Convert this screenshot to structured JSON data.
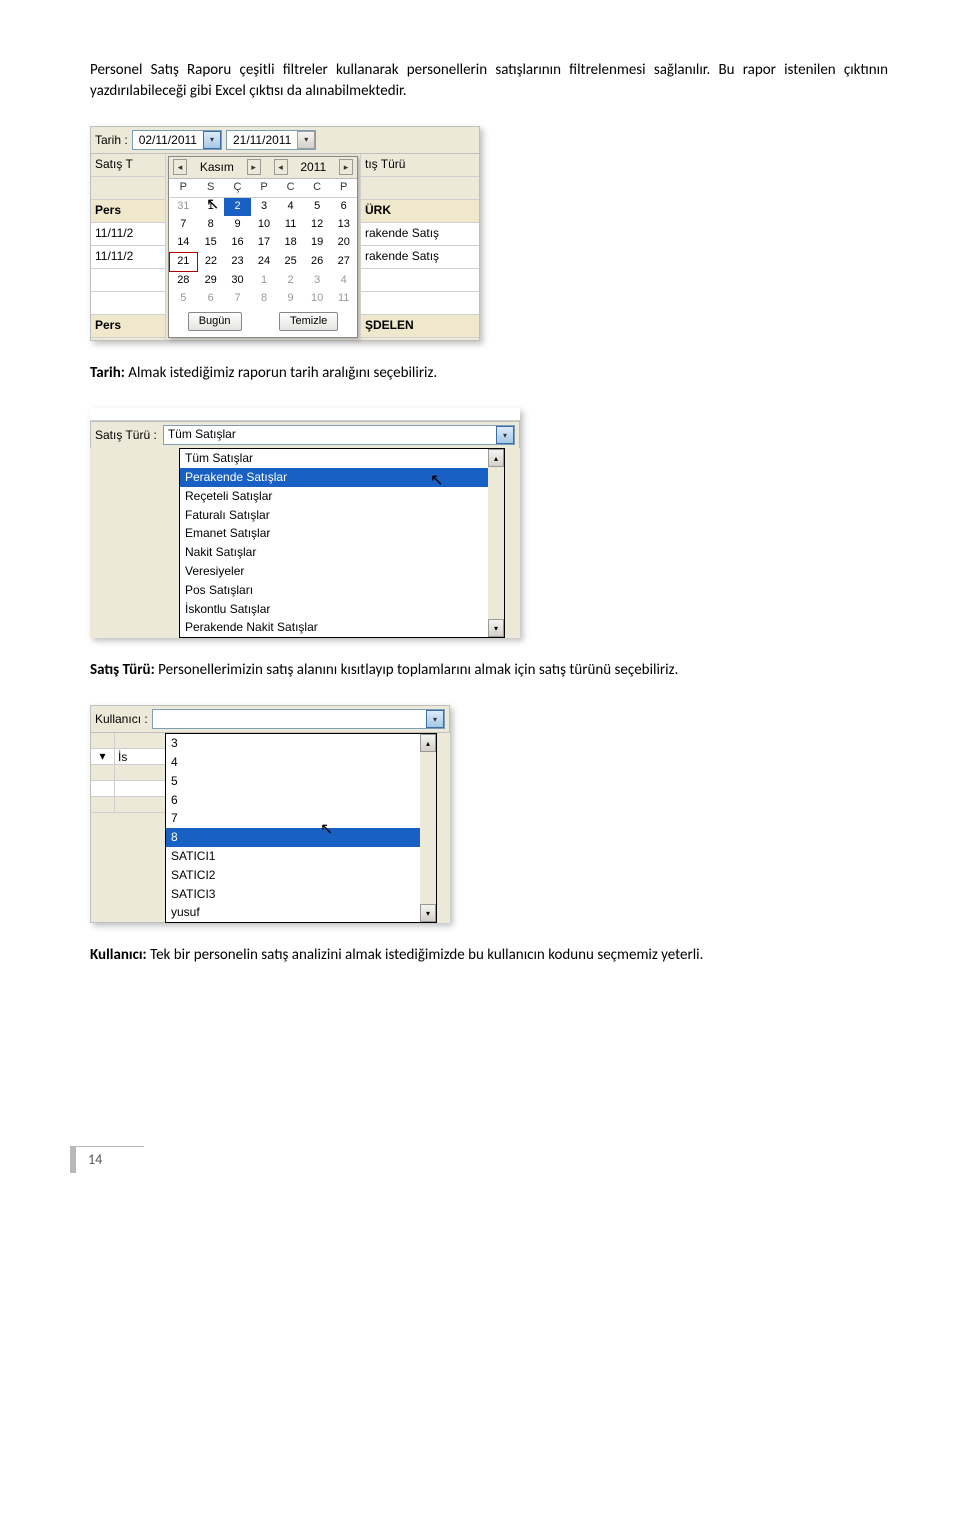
{
  "intro": "Personel Satış Raporu çeşitli filtreler kullanarak personellerin satışlarının filtrelenmesi sağlanılır. Bu rapor istenilen çıktının yazdırılabileceği gibi Excel çıktısı da alınabilmektedir.",
  "tarih_section": {
    "heading_bold": "Tarih:",
    "heading_rest": " Almak istediğimiz raporun tarih aralığını seçebiliriz."
  },
  "satis_section": {
    "heading_bold": "Satış Türü:",
    "heading_rest": " Personellerimizin satış alanını kısıtlayıp toplamlarını almak için satış türünü seçebiliriz."
  },
  "kullanici_section": {
    "heading_bold": "Kullanıcı:",
    "heading_rest": " Tek bir personelin satış analizini almak istediğimizde bu kullanıcın kodunu seçmemiz yeterli."
  },
  "shot1": {
    "tarih_label": "Tarih :",
    "date_from": "02/11/2011",
    "date_to": "21/11/2011",
    "left_rows": [
      "Satış T",
      "",
      "Pers",
      "11/11/2",
      "11/11/2",
      "",
      "",
      "Pers"
    ],
    "right_rows": [
      "tış Türü",
      "",
      "ÜRK",
      "rakende Satış",
      "rakende Satış",
      "",
      "",
      "ŞDELEN"
    ],
    "month_label": "Kasım",
    "year_label": "2011",
    "dow": [
      "P",
      "S",
      "Ç",
      "P",
      "C",
      "C",
      "P"
    ],
    "weeks": [
      [
        "31",
        "1",
        "2",
        "3",
        "4",
        "5",
        "6"
      ],
      [
        "7",
        "8",
        "9",
        "10",
        "11",
        "12",
        "13"
      ],
      [
        "14",
        "15",
        "16",
        "17",
        "18",
        "19",
        "20"
      ],
      [
        "21",
        "22",
        "23",
        "24",
        "25",
        "26",
        "27"
      ],
      [
        "28",
        "29",
        "30",
        "1",
        "2",
        "3",
        "4"
      ],
      [
        "5",
        "6",
        "7",
        "8",
        "9",
        "10",
        "11"
      ]
    ],
    "btn_today": "Bugün",
    "btn_clear": "Temizle"
  },
  "shot2": {
    "label": "Satış Türü :",
    "selected": "Tüm Satışlar",
    "items": [
      "Tüm Satışlar",
      "Perakende Satışlar",
      "Reçeteli Satışlar",
      "Faturalı Satışlar",
      "Emanet Satışlar",
      "Nakit Satışlar",
      "Veresiyeler",
      "Pos Satışları",
      "İskontlu Satışlar",
      "Perakende Nakit Satışlar"
    ],
    "highlight_index": 1
  },
  "shot3": {
    "label": "Kullanıcı :",
    "items": [
      "3",
      "4",
      "5",
      "6",
      "7",
      "8",
      "SATICI1",
      "SATICI2",
      "SATICI3",
      "yusuf"
    ],
    "highlight_index": 5,
    "left_mini": [
      "▾",
      "",
      "",
      ""
    ],
    "left_fill_label": "İs"
  },
  "page_number": "14"
}
